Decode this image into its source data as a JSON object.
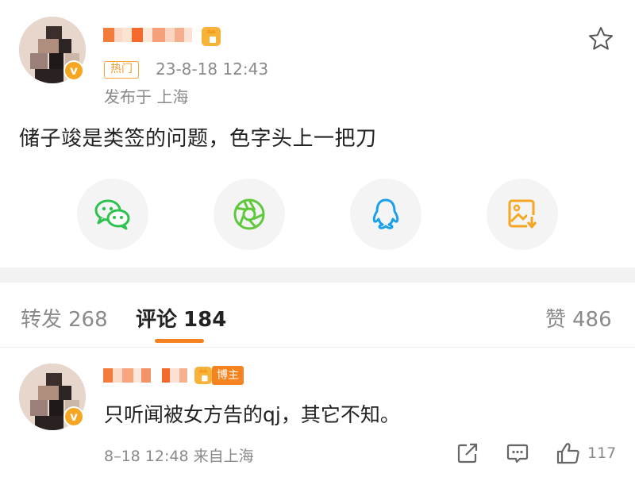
{
  "post": {
    "level_icon": "level-icon",
    "verified_icon": "v",
    "hot_tag": "热门",
    "time": "23-8-18 12:43",
    "location": "发布于 上海",
    "content": "储子竣是类签的问题，色字头上一把刀",
    "favorite_icon": "star-icon"
  },
  "share": [
    {
      "icon": "wechat-icon",
      "color": "#2dc24e"
    },
    {
      "icon": "moments-icon",
      "color": "#5fc83c"
    },
    {
      "icon": "qq-icon",
      "color": "#1aa0e8"
    },
    {
      "icon": "save-image-icon",
      "color": "#f5a623"
    }
  ],
  "tabs": {
    "repost_label": "转发",
    "repost_count": "268",
    "comment_label": "评论",
    "comment_count": "184",
    "like_label": "赞",
    "like_count": "486"
  },
  "comment": {
    "owner_badge": "博主",
    "verified_icon": "v",
    "text": "只听闻被女方告的qj，其它不知。",
    "meta": "8–18 12:48  来自上海",
    "like_count": "117"
  },
  "colors": {
    "accent": "#f5821f",
    "hot_tag": "#f29a2e",
    "muted_text": "#8a8a8a"
  }
}
